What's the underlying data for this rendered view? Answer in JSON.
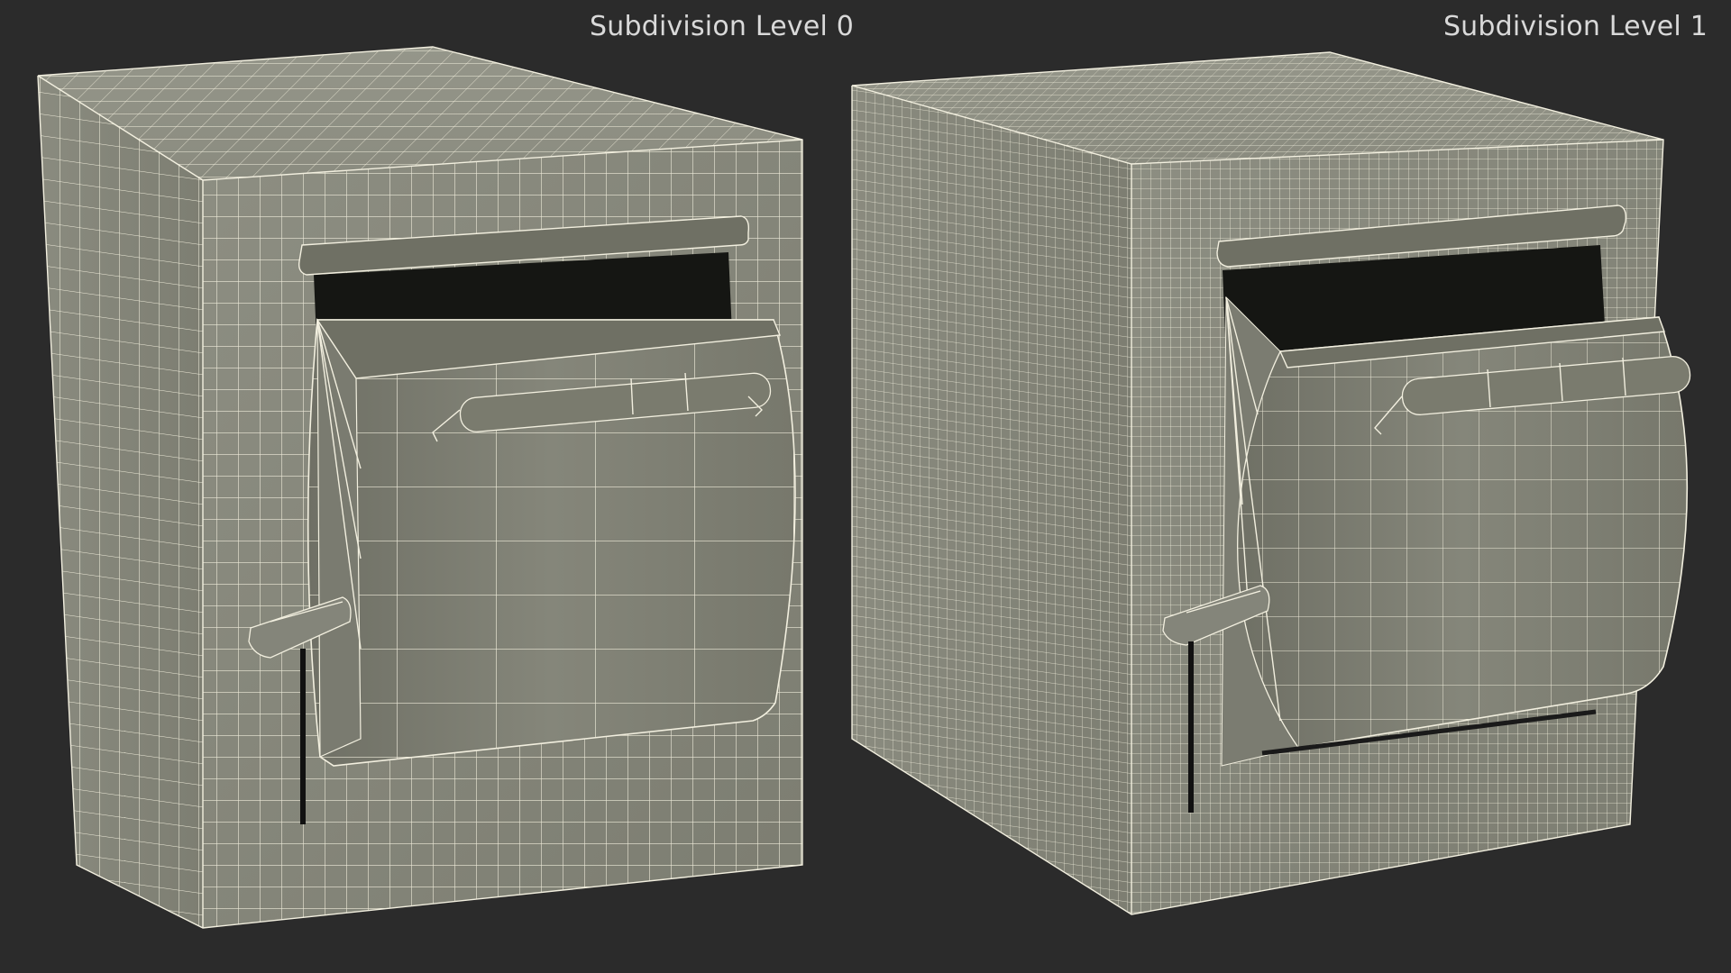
{
  "viewport": {
    "labels": [
      {
        "text": "Subdivision Level 0"
      },
      {
        "text": "Subdivision Level 1"
      }
    ]
  },
  "models": [
    {
      "name": "mailbox-level-0",
      "grid_density": "coarse"
    },
    {
      "name": "mailbox-level-1",
      "grid_density": "fine"
    }
  ],
  "colors": {
    "background": "#2b2b2b",
    "surface": "#8a8b7f",
    "wireframe": "#f2efdf",
    "label_text": "#d9d9d9"
  }
}
